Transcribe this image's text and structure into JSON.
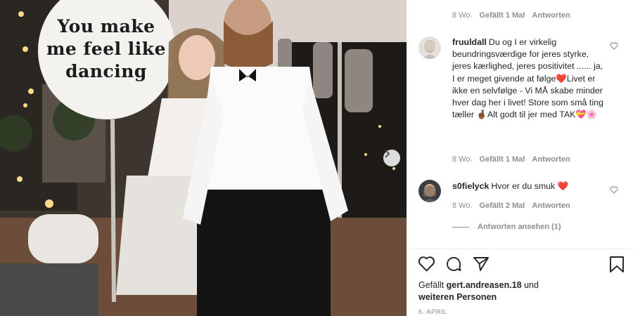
{
  "photo": {
    "balloon_lines": [
      "You make",
      "me feel like",
      "dancing"
    ]
  },
  "comments": [
    {
      "meta": {
        "time": "8 Wo.",
        "likes": "Gefällt 1 Mal",
        "reply": "Antworten"
      }
    },
    {
      "username": "fruuldall",
      "text": "Du og I er virkelig beundringsværdige for jeres styrke, jeres kærlighed, jeres positivitet ...... ja, I er meget givende at følge❤️Livet er ikke en selvfølge - Vi MÅ skabe minder hver dag her i livet! Store som små ting tæller 🤞🏾Alt godt til jer med TAK💝🌸",
      "meta": {
        "time": "8 Wo.",
        "likes": "Gefällt 1 Mal",
        "reply": "Antworten"
      }
    },
    {
      "username": "s0fielyck",
      "text": "Hvor er du smuk ❤️",
      "meta": {
        "time": "8 Wo.",
        "likes": "Gefällt 2 Mal",
        "reply": "Antworten"
      },
      "view_replies": "Antworten ansehen (1)"
    }
  ],
  "likes": {
    "prefix": "Gefällt",
    "user": "gert.andreasen.18",
    "conj": "und",
    "others": "weiteren Personen"
  },
  "date": "6. APRIL",
  "icons": {
    "like": "heart-icon",
    "comment": "comment-icon",
    "share": "paper-plane-icon",
    "save": "bookmark-icon",
    "next": "chevron-right-icon",
    "comment_like": "heart-outline-icon"
  }
}
